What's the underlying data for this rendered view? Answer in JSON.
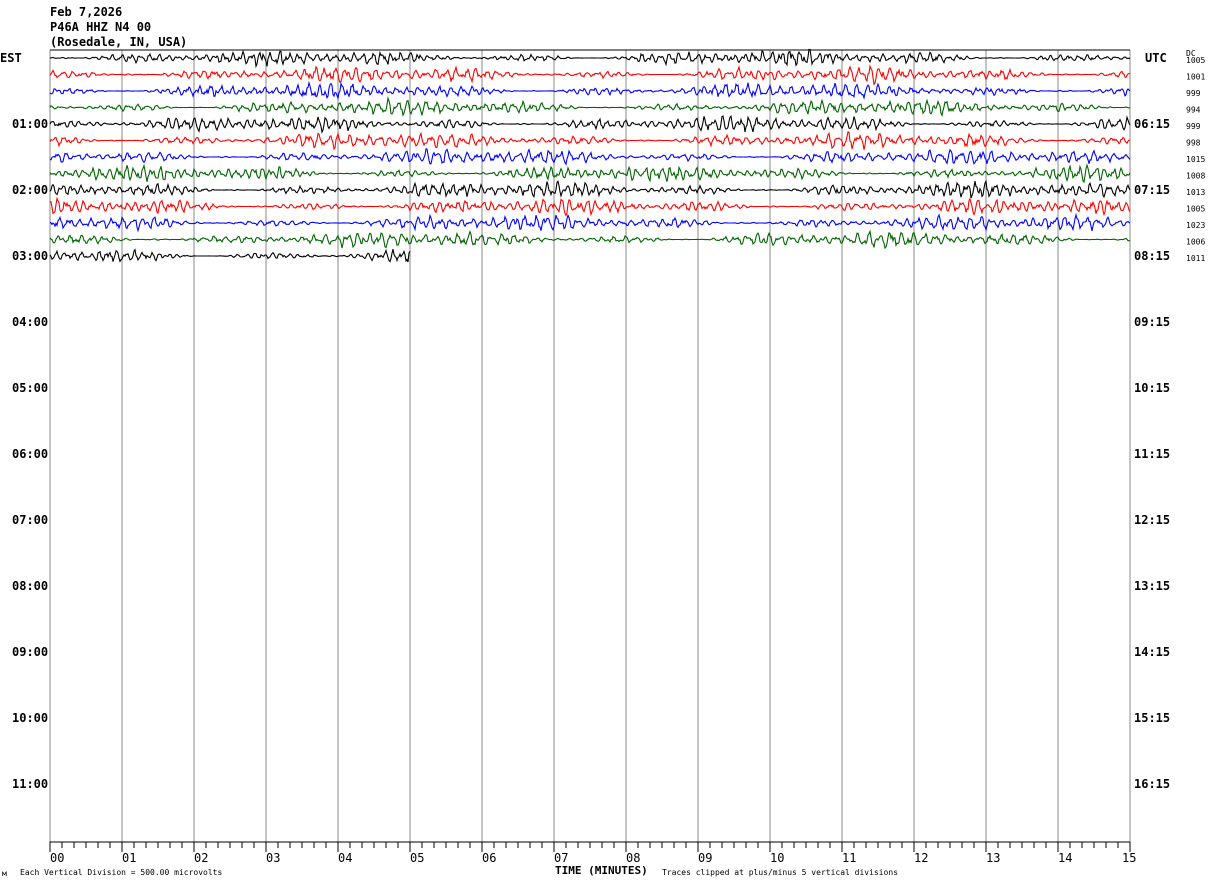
{
  "header": {
    "date": "Feb 7,2026",
    "station": "P46A HHZ N4 00",
    "location": "(Rosedale, IN, USA)"
  },
  "chart_data": {
    "type": "line",
    "title": "",
    "left_timezone": "EST",
    "right_timezone": "UTC",
    "dc_header": "DC",
    "xlabel": "TIME (MINUTES)",
    "xlim": [
      0,
      15
    ],
    "x_ticks": [
      "00",
      "01",
      "02",
      "03",
      "04",
      "05",
      "06",
      "07",
      "08",
      "09",
      "10",
      "11",
      "12",
      "13",
      "14",
      "15"
    ],
    "left_hour_labels": [
      "EST",
      "01:00",
      "02:00",
      "03:00",
      "04:00",
      "05:00",
      "06:00",
      "07:00",
      "08:00",
      "09:00",
      "10:00",
      "11:00"
    ],
    "right_hour_labels": [
      "UTC",
      "06:15",
      "07:15",
      "08:15",
      "09:15",
      "10:15",
      "11:15",
      "12:15",
      "13:15",
      "14:15",
      "15:15",
      "16:15"
    ],
    "trace_colors": [
      "#000000",
      "#ff0000",
      "#0000ff",
      "#006400"
    ],
    "traces": [
      {
        "dc": "1005",
        "end_minute": 15
      },
      {
        "dc": "1001",
        "end_minute": 15
      },
      {
        "dc": "999",
        "end_minute": 15
      },
      {
        "dc": "994",
        "end_minute": 15
      },
      {
        "dc": "999",
        "end_minute": 15
      },
      {
        "dc": "998",
        "end_minute": 15
      },
      {
        "dc": "1015",
        "end_minute": 15
      },
      {
        "dc": "1008",
        "end_minute": 15
      },
      {
        "dc": "1013",
        "end_minute": 15
      },
      {
        "dc": "1005",
        "end_minute": 15
      },
      {
        "dc": "1023",
        "end_minute": 15
      },
      {
        "dc": "1006",
        "end_minute": 15
      },
      {
        "dc": "1011",
        "end_minute": 5
      }
    ],
    "grid": true
  },
  "footer": {
    "scale_note": "Each Vertical Division =  500.00 microvolts",
    "clip_note": "Traces clipped at plus/minus 5 vertical divisions"
  }
}
